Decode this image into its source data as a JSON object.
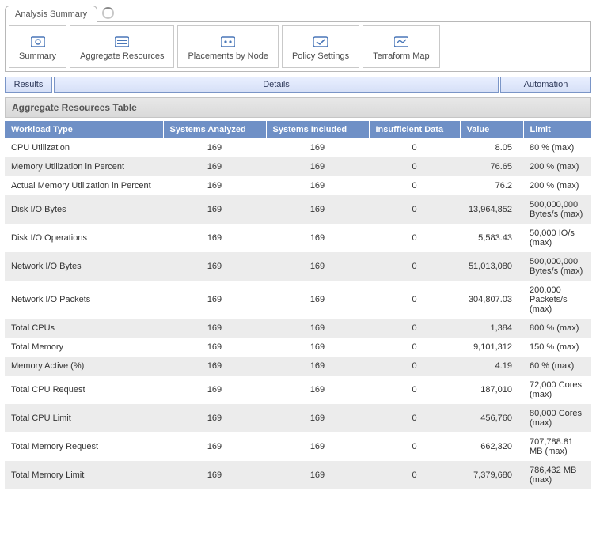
{
  "tab": {
    "label": "Analysis Summary"
  },
  "toolbar": {
    "items": [
      {
        "label": "Summary",
        "icon": "summary-icon"
      },
      {
        "label": "Aggregate Resources",
        "icon": "aggregate-icon"
      },
      {
        "label": "Placements by Node",
        "icon": "placements-icon"
      },
      {
        "label": "Policy Settings",
        "icon": "policy-icon"
      },
      {
        "label": "Terraform Map",
        "icon": "terraform-icon"
      }
    ]
  },
  "segbar": {
    "results": "Results",
    "details": "Details",
    "automation": "Automation"
  },
  "section_title": "Aggregate Resources Table",
  "columns": {
    "c1": "Workload Type",
    "c2": "Systems Analyzed",
    "c3": "Systems Included",
    "c4": "Insufficient Data",
    "c5": "Value",
    "c6": "Limit"
  },
  "rows": [
    {
      "c1": "CPU Utilization",
      "c2": "169",
      "c3": "169",
      "c4": "0",
      "c5": "8.05",
      "c6": "80 % (max)"
    },
    {
      "c1": "Memory Utilization in Percent",
      "c2": "169",
      "c3": "169",
      "c4": "0",
      "c5": "76.65",
      "c6": "200 % (max)"
    },
    {
      "c1": "Actual Memory Utilization in Percent",
      "c2": "169",
      "c3": "169",
      "c4": "0",
      "c5": "76.2",
      "c6": "200 % (max)"
    },
    {
      "c1": "Disk I/O Bytes",
      "c2": "169",
      "c3": "169",
      "c4": "0",
      "c5": "13,964,852",
      "c6": "500,000,000 Bytes/s (max)"
    },
    {
      "c1": "Disk I/O Operations",
      "c2": "169",
      "c3": "169",
      "c4": "0",
      "c5": "5,583.43",
      "c6": "50,000 IO/s (max)"
    },
    {
      "c1": "Network I/O Bytes",
      "c2": "169",
      "c3": "169",
      "c4": "0",
      "c5": "51,013,080",
      "c6": "500,000,000 Bytes/s (max)"
    },
    {
      "c1": "Network I/O Packets",
      "c2": "169",
      "c3": "169",
      "c4": "0",
      "c5": "304,807.03",
      "c6": "200,000 Packets/s (max)"
    },
    {
      "c1": "Total CPUs",
      "c2": "169",
      "c3": "169",
      "c4": "0",
      "c5": "1,384",
      "c6": "800 % (max)"
    },
    {
      "c1": "Total Memory",
      "c2": "169",
      "c3": "169",
      "c4": "0",
      "c5": "9,101,312",
      "c6": "150 % (max)"
    },
    {
      "c1": "Memory Active (%)",
      "c2": "169",
      "c3": "169",
      "c4": "0",
      "c5": "4.19",
      "c6": "60 % (max)"
    },
    {
      "c1": "Total CPU Request",
      "c2": "169",
      "c3": "169",
      "c4": "0",
      "c5": "187,010",
      "c6": "72,000 Cores (max)"
    },
    {
      "c1": "Total CPU Limit",
      "c2": "169",
      "c3": "169",
      "c4": "0",
      "c5": "456,760",
      "c6": "80,000 Cores (max)"
    },
    {
      "c1": "Total Memory Request",
      "c2": "169",
      "c3": "169",
      "c4": "0",
      "c5": "662,320",
      "c6": "707,788.81 MB (max)"
    },
    {
      "c1": "Total Memory Limit",
      "c2": "169",
      "c3": "169",
      "c4": "0",
      "c5": "7,379,680",
      "c6": "786,432 MB (max)"
    }
  ]
}
